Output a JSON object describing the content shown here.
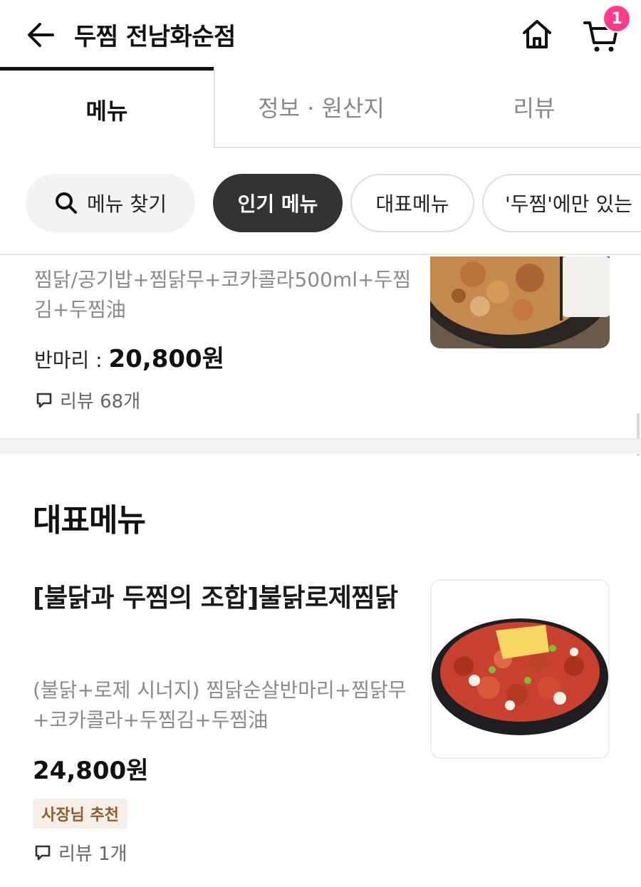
{
  "header": {
    "title": "두찜 전남화순점",
    "cart_count": "1"
  },
  "tabs": [
    {
      "label": "메뉴",
      "active": true
    },
    {
      "label": "정보 · 원산지",
      "active": false
    },
    {
      "label": "리뷰",
      "active": false
    }
  ],
  "chips": {
    "search": "메뉴 찾기",
    "popular": "인기 메뉴",
    "main": "대표메뉴",
    "unique": "'두찜'에만 있는"
  },
  "items": [
    {
      "desc": "찜닭/공기밥+찜닭무+코카콜라500ml+두찜김+두찜油",
      "price_label": "반마리 : ",
      "price": "20,800원",
      "review": "리뷰 68개"
    },
    {
      "name": "[불닭과 두찜의 조합]불닭로제찜닭",
      "desc": "(불닭+로제 시너지) 찜닭순살반마리+찜닭무+코카콜라+두찜김+두찜油",
      "price": "24,800원",
      "badge": "사장님 추천",
      "review": "리뷰 1개"
    }
  ],
  "section_title": "대표메뉴",
  "colors": {
    "badge_pink": "#ff3d8b",
    "chip_active": "#333333",
    "badge_bg": "#f5efe7",
    "badge_text": "#8b5e34"
  }
}
